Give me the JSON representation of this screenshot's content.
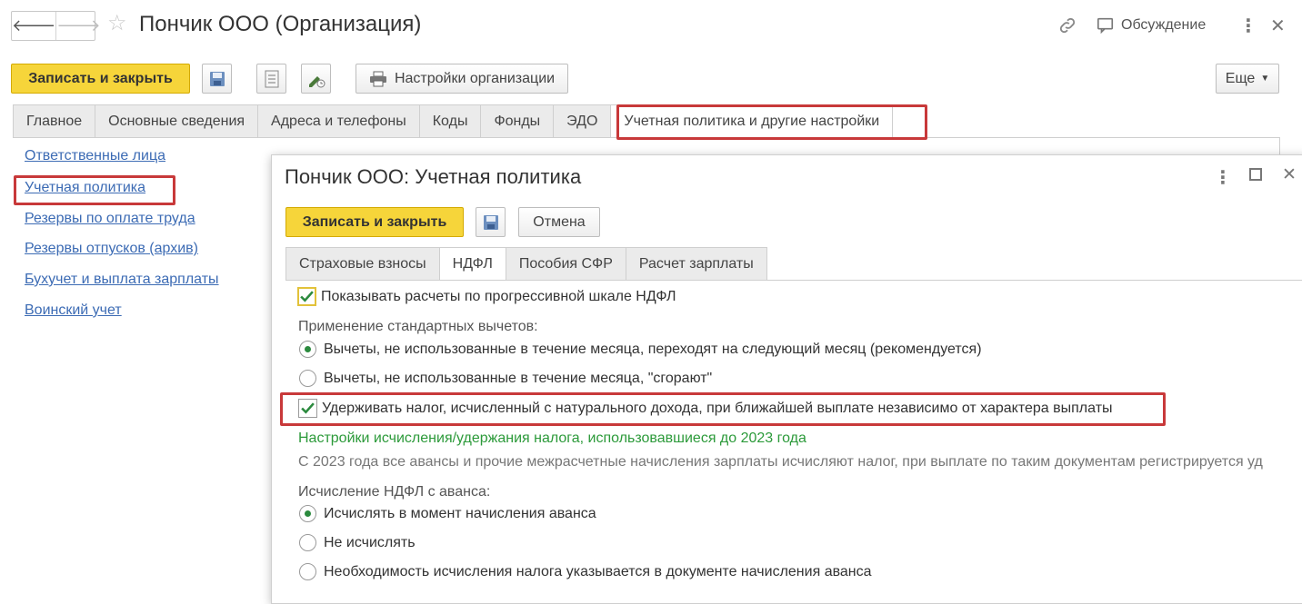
{
  "window": {
    "title": "Пончик ООО (Организация)",
    "discussion_label": "Обсуждение"
  },
  "toolbar": {
    "save_close_label": "Записать и закрыть",
    "org_settings_label": "Настройки организации",
    "more_label": "Еще"
  },
  "tabs": [
    {
      "label": "Главное"
    },
    {
      "label": "Основные сведения"
    },
    {
      "label": "Адреса и телефоны"
    },
    {
      "label": "Коды"
    },
    {
      "label": "Фонды"
    },
    {
      "label": "ЭДО"
    },
    {
      "label": "Учетная политика и другие настройки"
    }
  ],
  "sidebar": {
    "links": [
      {
        "label": "Ответственные лица"
      },
      {
        "label": "Учетная политика"
      },
      {
        "label": "Резервы по оплате труда"
      },
      {
        "label": "Резервы отпусков (архив)"
      },
      {
        "label": "Бухучет и выплата зарплаты"
      },
      {
        "label": "Воинский учет"
      }
    ]
  },
  "dialog": {
    "title": "Пончик ООО: Учетная политика",
    "save_close_label": "Записать и закрыть",
    "cancel_label": "Отмена",
    "tabs": [
      {
        "label": "Страховые взносы"
      },
      {
        "label": "НДФЛ"
      },
      {
        "label": "Пособия СФР"
      },
      {
        "label": "Расчет зарплаты"
      }
    ],
    "progressive_scale_label": "Показывать расчеты по прогрессивной шкале НДФЛ",
    "std_deductions_header": "Применение стандартных вычетов:",
    "deduction_option_1": "Вычеты, не использованные в течение месяца, переходят на следующий месяц (рекомендуется)",
    "deduction_option_2": "Вычеты, не использованные в течение месяца, \"сгорают\"",
    "natural_income_label": "Удерживать налог, исчисленный с натурального дохода, при ближайшей выплате независимо от характера выплаты",
    "pre2023_link": "Настройки исчисления/удержания налога, использовавшиеся до 2023 года",
    "info_text": "С 2023 года все авансы и прочие межрасчетные начисления зарплаты исчисляют налог, при выплате по таким документам регистрируется уд",
    "advance_header": "Исчисление НДФЛ с аванса:",
    "advance_option_1": "Исчислять в момент начисления аванса",
    "advance_option_2": "Не исчислять",
    "advance_option_3": "Необходимость исчисления налога указывается в документе начисления аванса"
  }
}
